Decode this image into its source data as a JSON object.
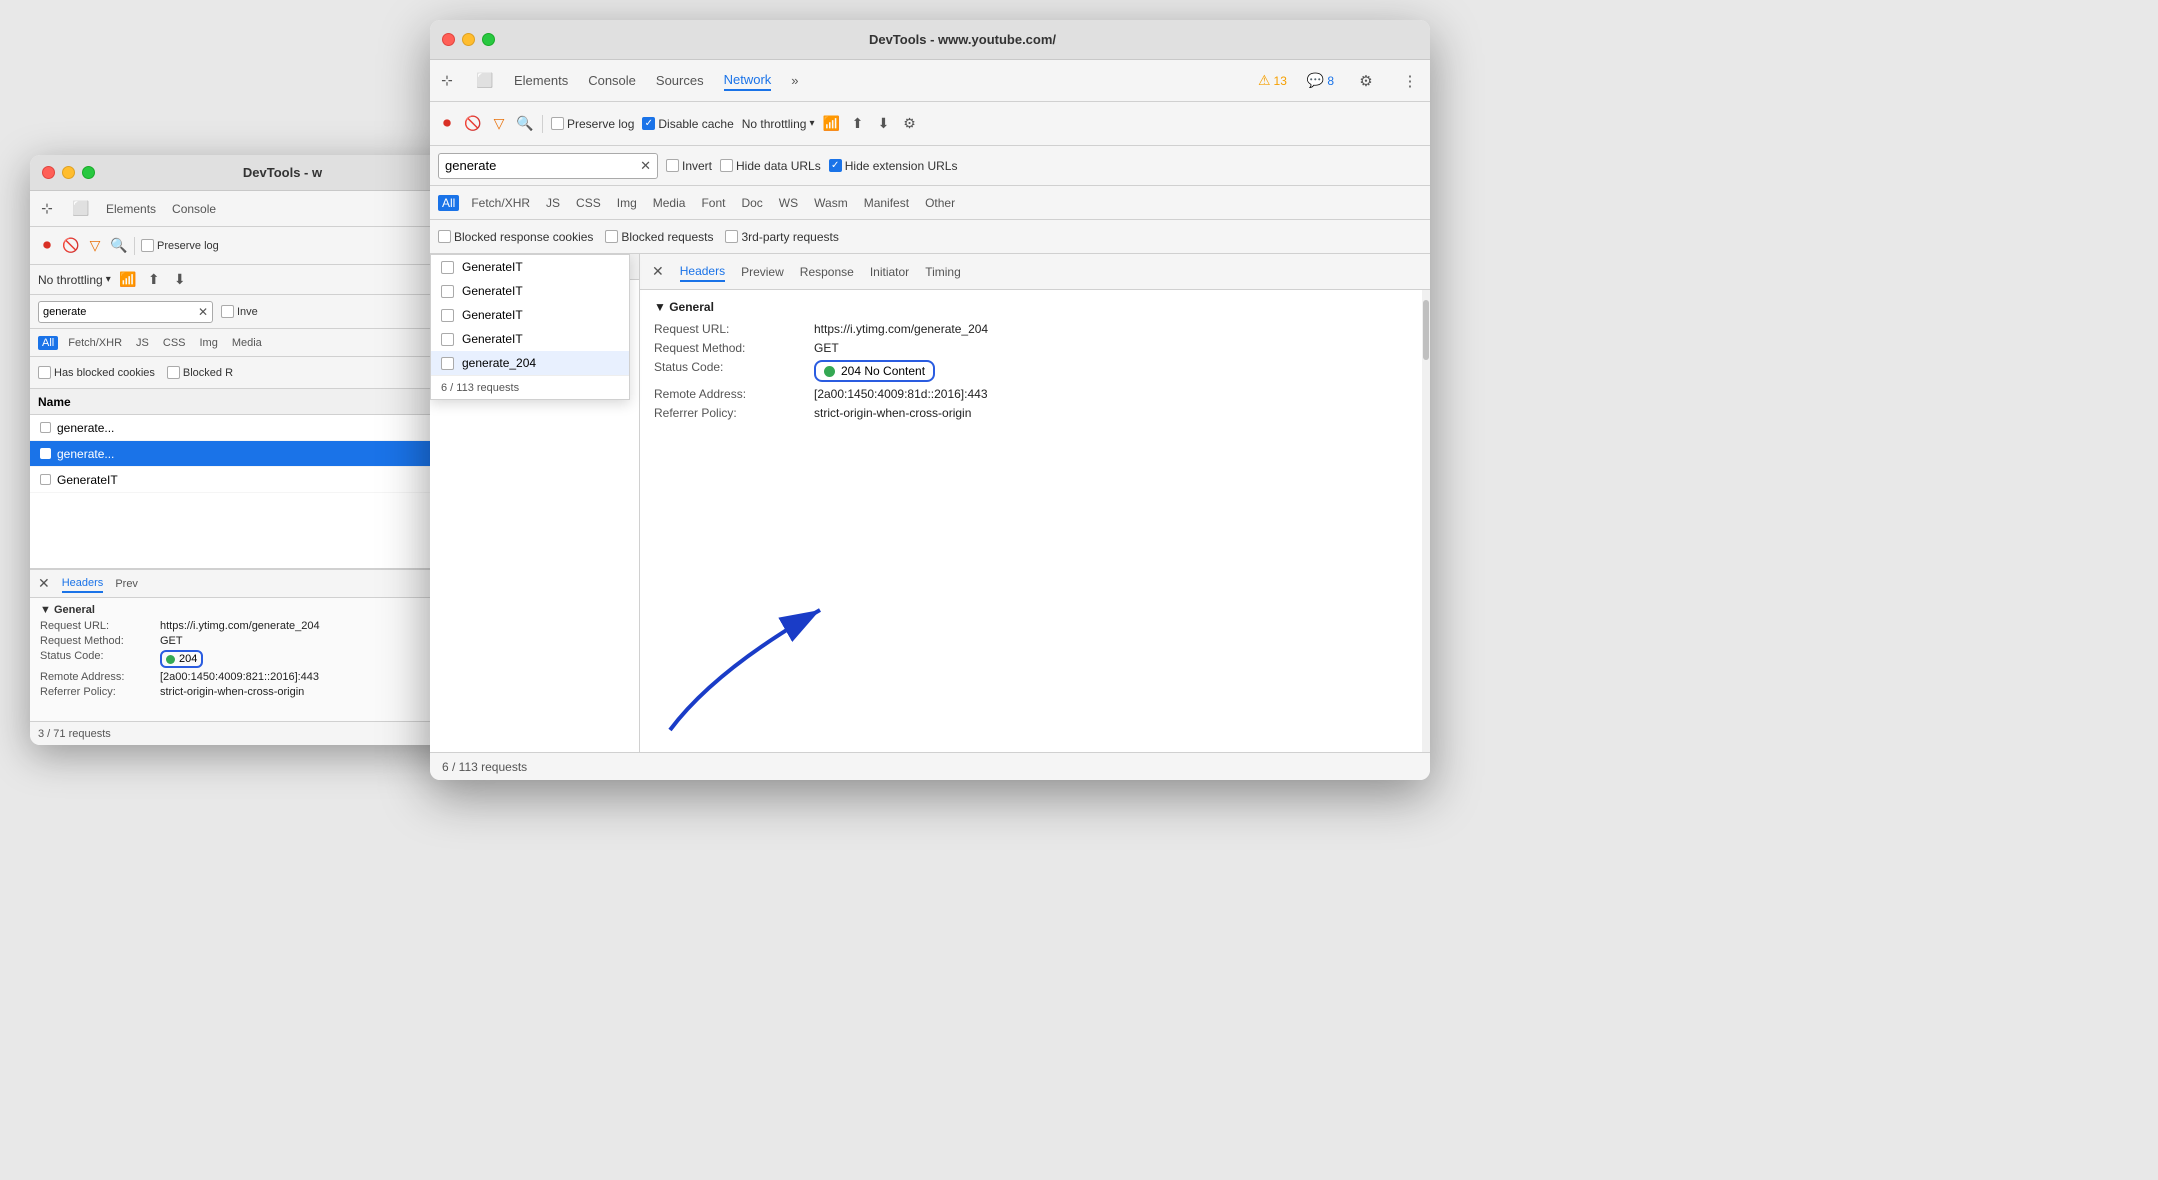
{
  "back_window": {
    "title": "DevTools - w",
    "tabs": [
      "Elements",
      "Console"
    ],
    "toolbar": {
      "preserve_log_label": "Preserve log",
      "throttle": "No throttling"
    },
    "search": {
      "value": "generate",
      "placeholder": "Filter"
    },
    "filter_tabs": [
      "All",
      "Fetch/XHR",
      "JS",
      "CSS",
      "Img",
      "Media"
    ],
    "filter_options": [
      "Has blocked cookies",
      "Blocked R"
    ],
    "list_header": "Name",
    "requests": [
      {
        "name": "generate...",
        "selected": false
      },
      {
        "name": "generate...",
        "selected": true
      },
      {
        "name": "GenerateIT",
        "selected": false
      }
    ],
    "detail": {
      "tabs": [
        "Headers",
        "Prev"
      ],
      "section": "General",
      "rows": [
        {
          "label": "Request URL:",
          "value": "https://i.ytimg.com/generate_204"
        },
        {
          "label": "Request Method:",
          "value": "GET"
        },
        {
          "label": "Status Code:",
          "value": "204",
          "highlight": true
        },
        {
          "label": "Remote Address:",
          "value": "[2a00:1450:4009:821::2016]:443"
        },
        {
          "label": "Referrer Policy:",
          "value": "strict-origin-when-cross-origin"
        }
      ]
    },
    "footer": "3 / 71 requests"
  },
  "front_window": {
    "title": "DevTools - www.youtube.com/",
    "tabs": [
      {
        "label": "Elements",
        "active": false
      },
      {
        "label": "Console",
        "active": false
      },
      {
        "label": "Sources",
        "active": false
      },
      {
        "label": "Network",
        "active": true
      },
      {
        "label": "»",
        "active": false
      }
    ],
    "badges": {
      "warning": "13",
      "chat": "8"
    },
    "toolbar": {
      "preserve_log_label": "Preserve log",
      "disable_cache_label": "Disable cache",
      "throttle": "No throttling"
    },
    "search": {
      "value": "generate",
      "placeholder": "Filter"
    },
    "checkboxes": {
      "preserve_log": false,
      "disable_cache": true,
      "invert": false,
      "hide_data_urls": false,
      "hide_extension_urls": true
    },
    "filter_tabs": [
      "All",
      "Fetch/XHR",
      "JS",
      "CSS",
      "Img",
      "Media",
      "Font",
      "Doc",
      "WS",
      "Wasm",
      "Manifest",
      "Other"
    ],
    "blocked": {
      "blocked_response_cookies": "Blocked response cookies",
      "blocked_requests": "Blocked requests",
      "third_party": "3rd-party requests"
    },
    "autocomplete": {
      "items": [
        {
          "name": "GenerateIT",
          "highlighted": false
        },
        {
          "name": "GenerateIT",
          "highlighted": false
        },
        {
          "name": "GenerateIT",
          "highlighted": false
        },
        {
          "name": "GenerateIT",
          "highlighted": false
        },
        {
          "name": "generate_204",
          "highlighted": true
        }
      ],
      "footer": "6 / 113 requests"
    },
    "detail": {
      "close_label": "×",
      "tabs": [
        "Headers",
        "Preview",
        "Response",
        "Initiator",
        "Timing"
      ],
      "section": "▼ General",
      "rows": [
        {
          "label": "Request URL:",
          "value": "https://i.ytimg.com/generate_204"
        },
        {
          "label": "Request Method:",
          "value": "GET"
        },
        {
          "label": "Status Code:",
          "value": "204 No Content",
          "highlight": true
        },
        {
          "label": "Remote Address:",
          "value": "[2a00:1450:4009:81d::2016]:443"
        },
        {
          "label": "Referrer Policy:",
          "value": "strict-origin-when-cross-origin"
        }
      ]
    },
    "footer": "6 / 113 requests"
  }
}
